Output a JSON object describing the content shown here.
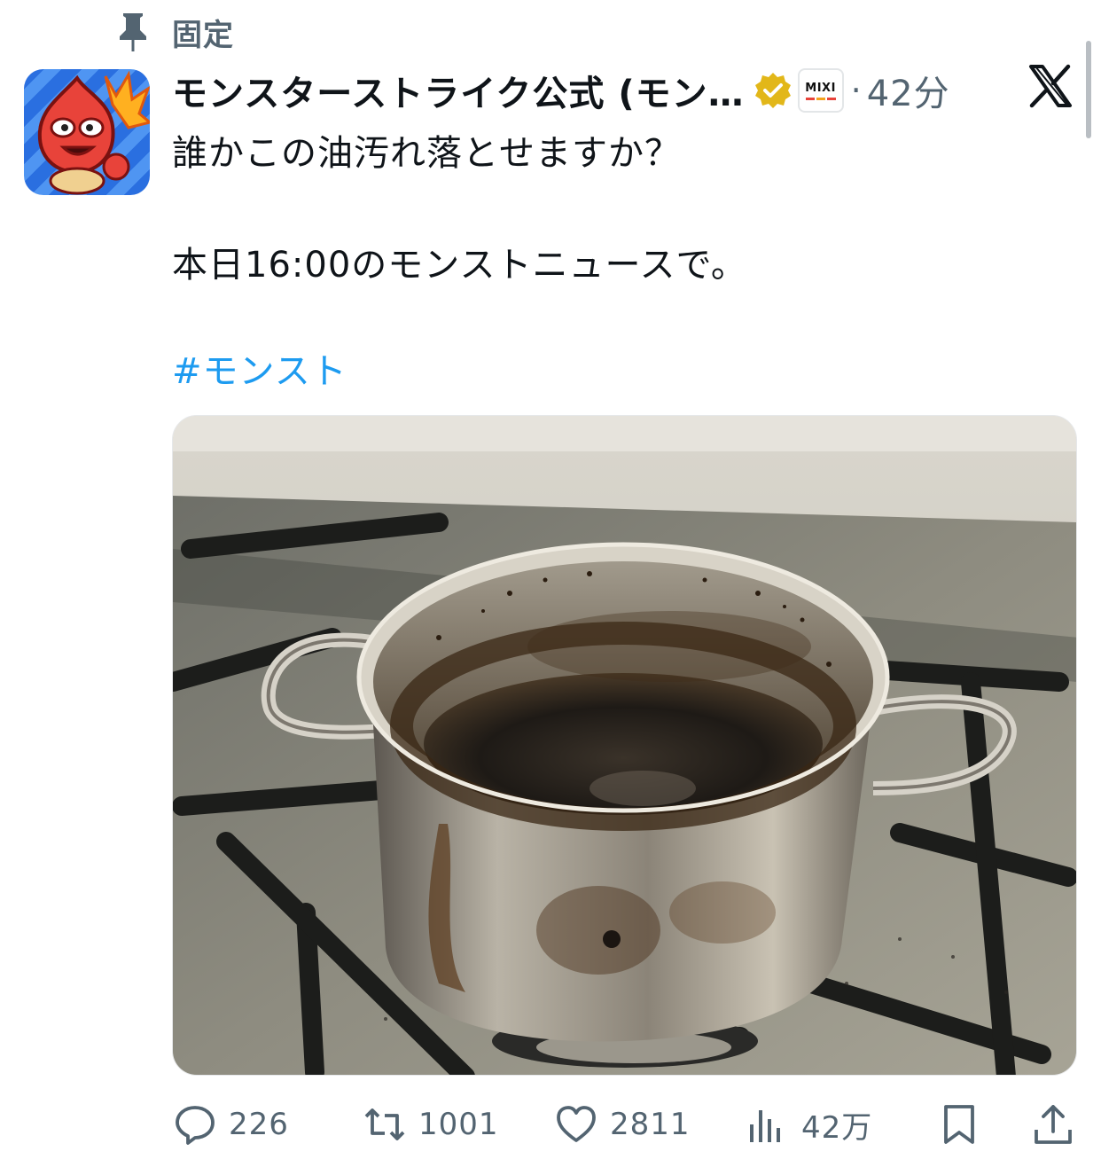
{
  "pinned": {
    "label": "固定"
  },
  "author": {
    "display_name": "モンスターストライク公式 (モン…",
    "affiliate_badge_text": "MIXI"
  },
  "meta": {
    "separator": "·",
    "time": "42分"
  },
  "tweet": {
    "lines": [
      "誰かこの油汚れ落とせますか？",
      "本日16:00のモンストニュースで。"
    ],
    "hashtag": "#モンスト"
  },
  "actions": {
    "replies": "226",
    "reposts": "1001",
    "likes": "2811",
    "views": "42万"
  },
  "icons": {
    "pin": "pin-icon",
    "verified": "verified-gold-badge-icon",
    "platform": "x-logo-icon",
    "reply": "reply-bubble-icon",
    "repost": "repost-arrows-icon",
    "like": "heart-icon",
    "views": "bar-chart-icon",
    "bookmark": "bookmark-icon",
    "share": "share-upload-icon"
  },
  "colors": {
    "link": "#1d9bf0",
    "secondary_text": "#536471",
    "verified_gold": "#e2b719"
  }
}
